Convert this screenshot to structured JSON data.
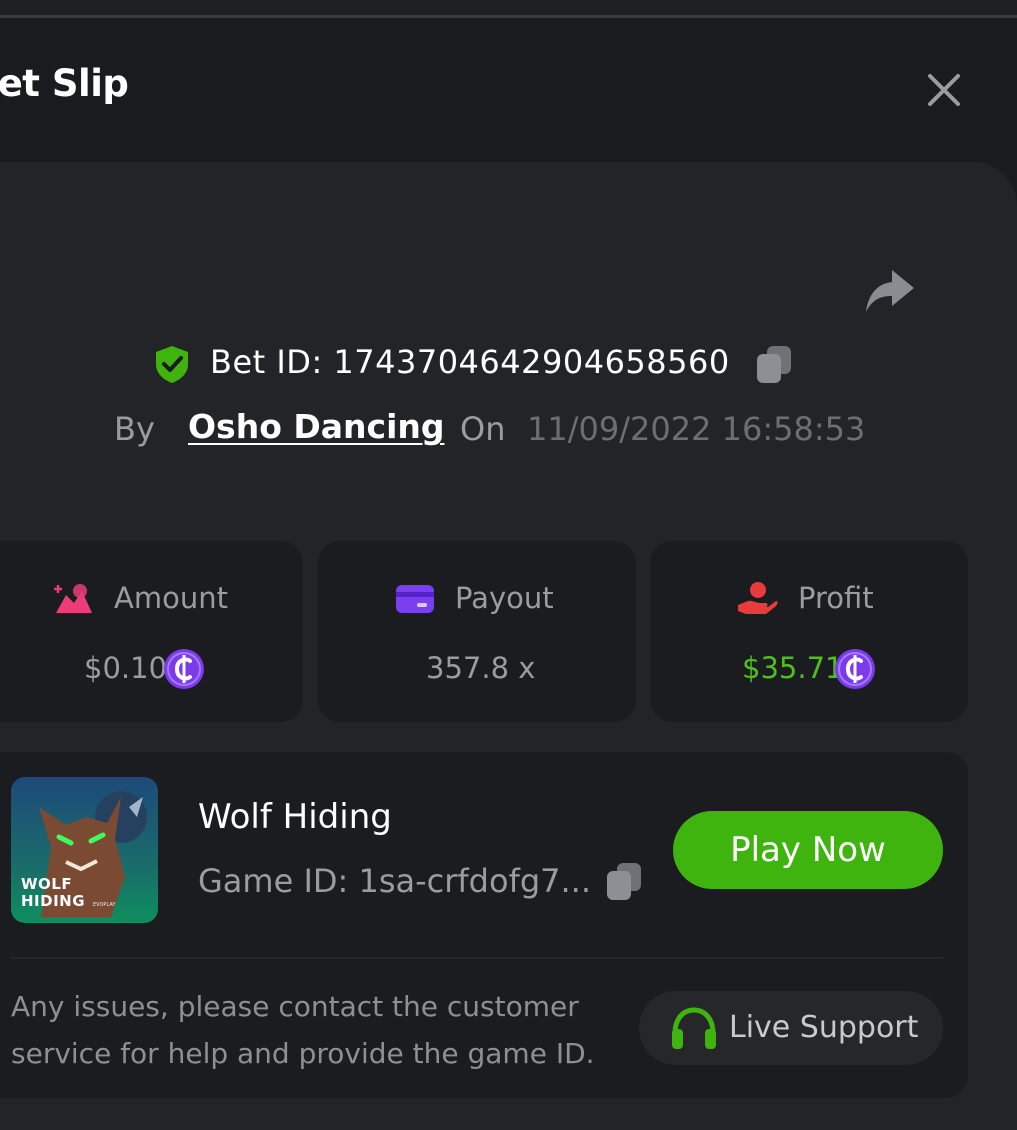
{
  "header": {
    "title": "Bet Slip"
  },
  "bet": {
    "id_label": "Bet ID: 1743704642904658560",
    "by_label": "By",
    "user": "Osho Dancing",
    "on_label": "On",
    "date": "11/09/2022 16:58:53"
  },
  "stats": {
    "amount": {
      "label": "Amount",
      "value": "$0.10"
    },
    "payout": {
      "label": "Payout",
      "value": "357.8 x"
    },
    "profit": {
      "label": "Profit",
      "value": "$35.71"
    }
  },
  "game": {
    "name": "Wolf Hiding",
    "id_text": "Game ID: 1sa-crfdofg7...",
    "thumb_title_line1": "WOLF",
    "thumb_title_line2": "HIDING",
    "thumb_brand": "EVOPLAY",
    "play_label": "Play Now",
    "help_text": "Any issues, please contact the customer service for help and provide the game ID.",
    "support_label": "Live Support"
  },
  "colors": {
    "accent_green": "#3fb30e",
    "profit_green": "#4fbf1a",
    "coin_purple": "#7c3aed",
    "amount_pink": "#ec3d78",
    "payout_purple": "#7b3ff2",
    "profit_red": "#e83c3c"
  },
  "icons": [
    "close-icon",
    "share-icon",
    "shield-check-icon",
    "copy-icon",
    "amount-icon",
    "card-icon",
    "profit-icon",
    "coin-icon",
    "headset-icon"
  ]
}
